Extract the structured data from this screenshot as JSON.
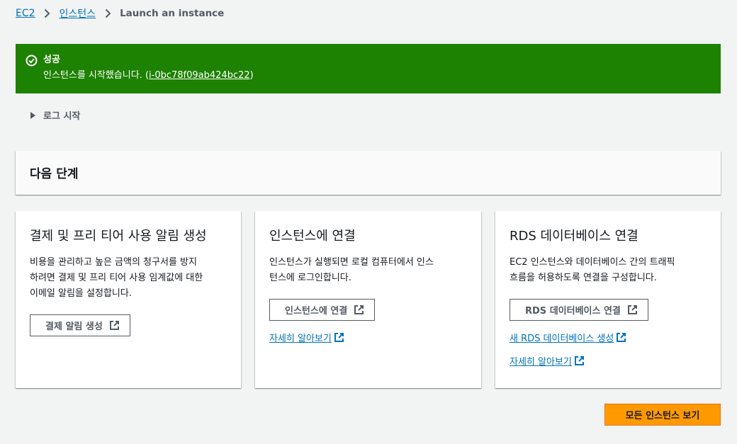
{
  "breadcrumb": {
    "items": [
      "EC2",
      "인스턴스"
    ],
    "current": "Launch an instance"
  },
  "flash": {
    "title": "성공",
    "message_prefix": "인스턴스를 시작했습니다. (",
    "instance_id": "i-0bc78f09ab424bc22",
    "message_suffix": ")",
    "color": "#1d8102"
  },
  "log": {
    "label": "로그 시작"
  },
  "next_steps": {
    "title": "다음 단계"
  },
  "cards": [
    {
      "title": "결제 및 프리 티어 사용 알림 생성",
      "description_lines": [
        "비용을 관리하고 높은 금액의 청구서를 방지",
        "하려면 결제 및 프리 티어 사용 임계값에 대한",
        "이메일 알림을 설정합니다."
      ],
      "button": "결제 알림 생성"
    },
    {
      "title": "인스턴스에 연결",
      "description_lines": [
        "인스턴스가 실행되면 로컬 컴퓨터에서 인스",
        "턴스에 로그인합니다."
      ],
      "button": "인스턴스에 연결",
      "links": [
        "자세히 알아보기"
      ]
    },
    {
      "title": "RDS 데이터베이스 연결",
      "description_lines": [
        "EC2 인스턴스와 데이터베이스 간의 트래픽",
        "흐름을 허용하도록 연결을 구성합니다."
      ],
      "button": "RDS 데이터베이스 연결",
      "links": [
        "새 RDS 데이터베이스 생성",
        "자세히 알아보기"
      ]
    }
  ],
  "footer": {
    "primary_button": "모든 인스턴스 보기",
    "primary_color": "#ff9900"
  },
  "colors": {
    "link": "#0073bb",
    "background": "#f2f3f3"
  }
}
